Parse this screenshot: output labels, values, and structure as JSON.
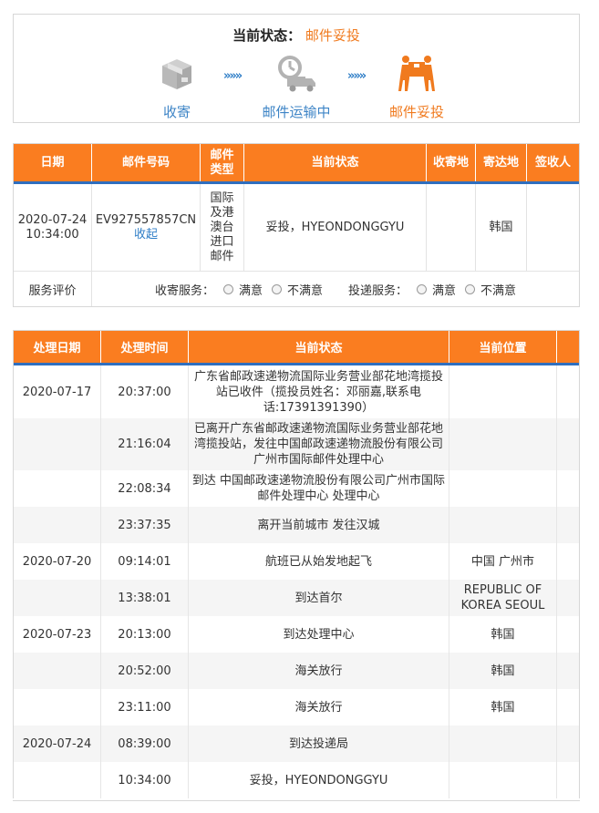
{
  "status": {
    "label": "当前状态：",
    "value": "邮件妥投",
    "steps": [
      {
        "label": "收寄",
        "icon": "package-box-icon"
      },
      {
        "label": "邮件运输中",
        "icon": "delivery-truck-icon"
      },
      {
        "label": "邮件妥投",
        "icon": "delivery-person-icon"
      }
    ],
    "arrow": "»»»",
    "colors": {
      "accent": "#f07a1e",
      "link": "#3d84c6"
    }
  },
  "mail_table": {
    "headers": [
      "日期",
      "邮件号码",
      "邮件类型",
      "当前状态",
      "收寄地",
      "寄达地",
      "签收人"
    ],
    "row": {
      "date": "2020-07-24 10:34:00",
      "number": "EV927557857CN",
      "number_link": "收起",
      "type": "国际及港澳台进口邮件",
      "status": "妥投，HYEONDONGGYU",
      "origin": "",
      "destination": "韩国",
      "signer": ""
    },
    "evaluation": {
      "label": "服务评价",
      "pickup_label": "收寄服务：",
      "delivery_label": "投递服务：",
      "satisfied": "满意",
      "unsatisfied": "不满意"
    },
    "colors": {
      "header_bg": "#fa7d20",
      "header_border": "#2f6fbf"
    }
  },
  "tracking_table": {
    "headers": [
      "处理日期",
      "处理时间",
      "当前状态",
      "当前位置"
    ],
    "rows": [
      {
        "date": "2020-07-17",
        "time": "20:37:00",
        "status": "广东省邮政速递物流国际业务营业部花地湾揽投站已收件（揽投员姓名：邓丽嘉,联系电话:17391391390）",
        "location": ""
      },
      {
        "date": "",
        "time": "21:16:04",
        "status": "已离开广东省邮政速递物流国际业务营业部花地湾揽投站，发往中国邮政速递物流股份有限公司广州市国际邮件处理中心",
        "location": ""
      },
      {
        "date": "",
        "time": "22:08:34",
        "status": "到达 中国邮政速递物流股份有限公司广州市国际邮件处理中心 处理中心",
        "location": ""
      },
      {
        "date": "",
        "time": "23:37:35",
        "status": "离开当前城市 发往汉城",
        "location": ""
      },
      {
        "date": "2020-07-20",
        "time": "09:14:01",
        "status": "航班已从始发地起飞",
        "location": "中国 广州市"
      },
      {
        "date": "",
        "time": "13:38:01",
        "status": "到达首尔",
        "location": "REPUBLIC OF KOREA SEOUL"
      },
      {
        "date": "2020-07-23",
        "time": "20:13:00",
        "status": "到达处理中心",
        "location": "韩国"
      },
      {
        "date": "",
        "time": "20:52:00",
        "status": "海关放行",
        "location": "韩国"
      },
      {
        "date": "",
        "time": "23:11:00",
        "status": "海关放行",
        "location": "韩国"
      },
      {
        "date": "2020-07-24",
        "time": "08:39:00",
        "status": "到达投递局",
        "location": ""
      },
      {
        "date": "",
        "time": "10:34:00",
        "status": "妥投，HYEONDONGGYU",
        "location": ""
      }
    ]
  }
}
